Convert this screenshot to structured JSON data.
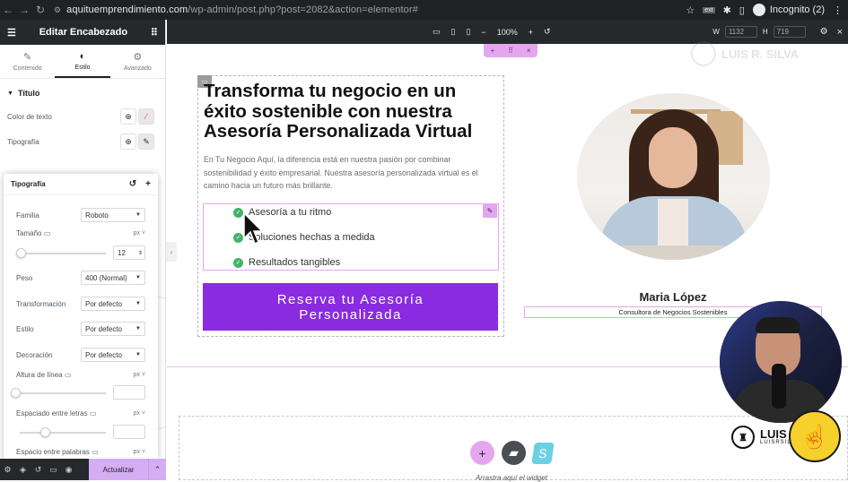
{
  "browser": {
    "nav_back": "←",
    "nav_forward": "→",
    "nav_reload": "↻",
    "url_host": "aquituemprendimiento.com",
    "url_path": "/wp-admin/post.php?post=2082&action=elementor#",
    "incognito_label": "Incognito (2)"
  },
  "panel": {
    "title": "Editar Encabezado",
    "tabs": [
      {
        "label": "Contenido",
        "icon": "pencil-icon"
      },
      {
        "label": "Estilo",
        "icon": "half-circle-icon"
      },
      {
        "label": "Avanzado",
        "icon": "gear-icon"
      }
    ],
    "section_title": "Título",
    "text_color_label": "Color de texto",
    "typography_label": "Tipografía",
    "typography_popover": {
      "title": "Tipografía",
      "family_label": "Familia",
      "family_value": "Roboto",
      "size_label": "Tamaño",
      "size_unit": "px",
      "size_value": "12",
      "weight_label": "Peso",
      "weight_value": "400 (Normal)",
      "transform_label": "Transformación",
      "transform_value": "Por defecto",
      "style_label": "Estilo",
      "style_value": "Por defecto",
      "decoration_label": "Decoración",
      "decoration_value": "Por defecto",
      "line_height_label": "Altura de línea",
      "line_height_unit": "px",
      "letter_spacing_label": "Espaciado entre letras",
      "letter_spacing_unit": "px",
      "word_spacing_label": "Espacio entre palabras",
      "word_spacing_unit": "px"
    },
    "update_button": "Actualizar"
  },
  "toolbar": {
    "zoom": "100%",
    "zoom_minus": "−",
    "zoom_plus": "+",
    "width_label": "W",
    "width_value": "1132",
    "height_label": "H",
    "height_value": "719"
  },
  "canvas": {
    "section_handle": {
      "add": "+",
      "move": "⠿",
      "close": "×"
    },
    "heading": "Transforma tu negocio en un éxito sostenible con nuestra Asesoría Personalizada Virtual",
    "paragraph": "En Tu Negocio Aquí, la diferencia está en nuestra pasión por combinar sostenibilidad y éxito empresarial. Nuestra asesoría personalizada virtual es el camino hacia un futuro más brillante.",
    "list": [
      "Asesoría a tu ritmo",
      "Soluciones hechas a medida",
      "Resultados tangibles"
    ],
    "cta": "Reserva tu Asesoría Personalizada",
    "person_name": "Maria López",
    "person_role": "Consultora de Negocios Sostenibles",
    "drop_text": "Arrastra aquí el widget",
    "watermark": "LUIS R. SILVA"
  },
  "overlay": {
    "logo_text": "LUIS R. SILVA",
    "logo_sub": "LUISRSILVA.COM"
  },
  "colors": {
    "accent_purple": "#8a2be2",
    "editor_pink": "#e5a6f0",
    "check_green": "#43b36a",
    "panel_dark": "#26292c"
  }
}
